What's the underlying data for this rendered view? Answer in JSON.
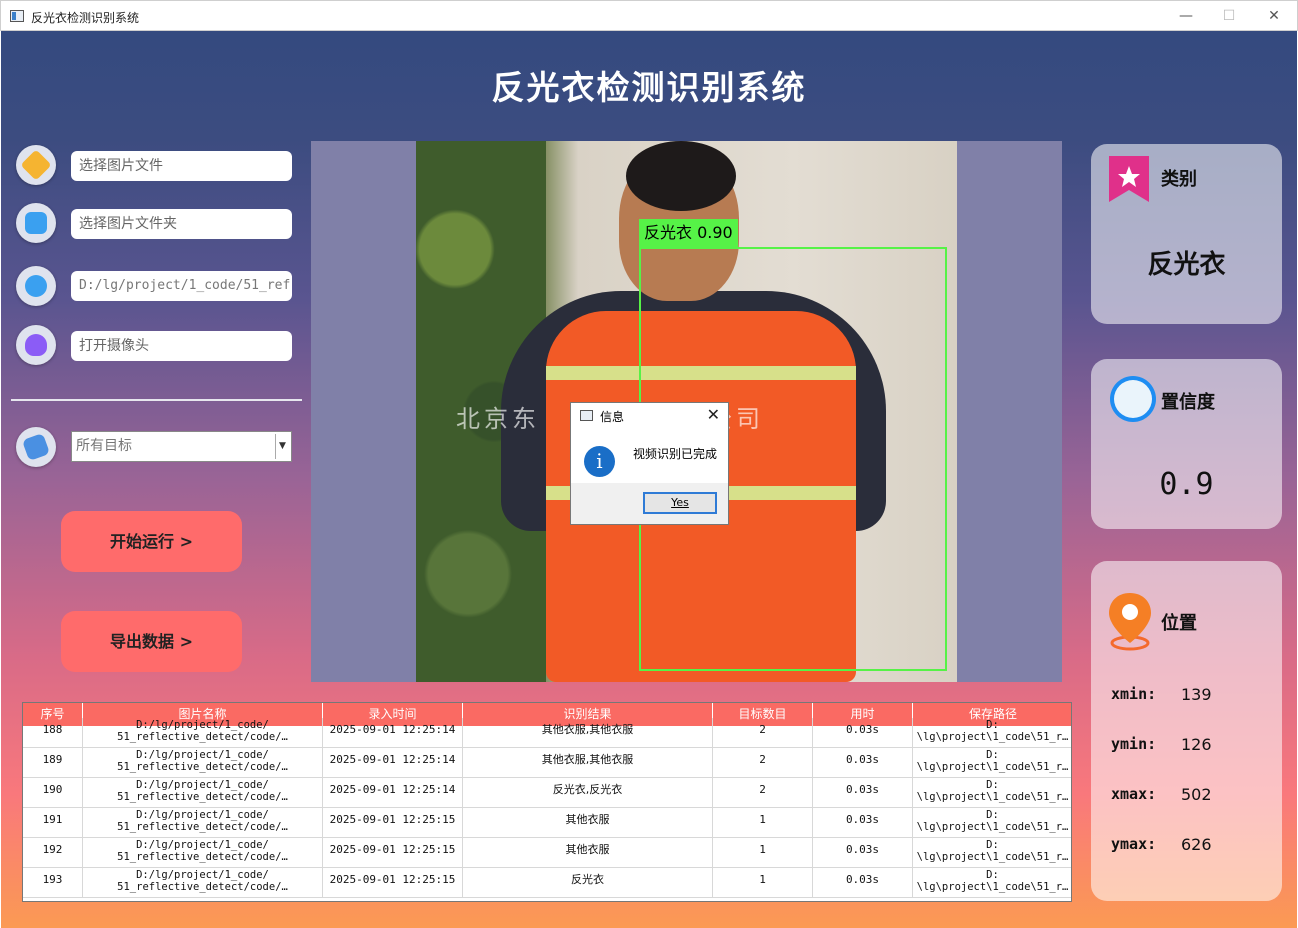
{
  "window": {
    "title": "反光衣检测识别系统",
    "minimize": "—",
    "maximize": "☐",
    "close": "✕"
  },
  "app": {
    "title": "反光衣检测识别系统"
  },
  "sidebar": {
    "image_file_placeholder": "选择图片文件",
    "image_folder_placeholder": "选择图片文件夹",
    "video_path_value": "D:/lg/project/1_code/51_ref",
    "camera_placeholder": "打开摄像头",
    "target_select_value": "所有目标",
    "start_button": "开始运行 >",
    "export_button": "导出数据 >",
    "icon_colors": {
      "image": "#f5b431",
      "folder": "#3aa0f0",
      "video": "#3aa0f0",
      "camera": "#8b5cf6",
      "target": "#4a90e2"
    }
  },
  "viewer": {
    "box_label": "反光衣 0.90",
    "watermark": "北京东　　　技有限公司"
  },
  "dialog": {
    "title": "信息",
    "close": "✕",
    "message": "视频识别已完成",
    "info_glyph": "i",
    "ok_button": "Yes"
  },
  "cards": {
    "class": {
      "title": "类别",
      "value": "反光衣"
    },
    "confidence": {
      "title": "置信度",
      "value": "0.9"
    },
    "position": {
      "title": "位置",
      "xmin_label": "xmin:",
      "xmin": "139",
      "ymin_label": "ymin:",
      "ymin": "126",
      "xmax_label": "xmax:",
      "xmax": "502",
      "ymax_label": "ymax:",
      "ymax": "626"
    }
  },
  "table": {
    "headers": [
      "序号",
      "图片名称",
      "录入时间",
      "识别结果",
      "目标数目",
      "用时",
      "保存路径"
    ],
    "rows": [
      {
        "id": "188",
        "name1": "D:/lg/project/1_code/",
        "name2": "51_reflective_detect/code/…",
        "time": "2025-09-01 12:25:14",
        "result": "其他衣服,其他衣服",
        "count": "2",
        "duration": "0.03s",
        "path1": "D:",
        "path2": "\\lg\\project\\1_code\\51_r…"
      },
      {
        "id": "189",
        "name1": "D:/lg/project/1_code/",
        "name2": "51_reflective_detect/code/…",
        "time": "2025-09-01 12:25:14",
        "result": "其他衣服,其他衣服",
        "count": "2",
        "duration": "0.03s",
        "path1": "D:",
        "path2": "\\lg\\project\\1_code\\51_r…"
      },
      {
        "id": "190",
        "name1": "D:/lg/project/1_code/",
        "name2": "51_reflective_detect/code/…",
        "time": "2025-09-01 12:25:14",
        "result": "反光衣,反光衣",
        "count": "2",
        "duration": "0.03s",
        "path1": "D:",
        "path2": "\\lg\\project\\1_code\\51_r…"
      },
      {
        "id": "191",
        "name1": "D:/lg/project/1_code/",
        "name2": "51_reflective_detect/code/…",
        "time": "2025-09-01 12:25:15",
        "result": "其他衣服",
        "count": "1",
        "duration": "0.03s",
        "path1": "D:",
        "path2": "\\lg\\project\\1_code\\51_r…"
      },
      {
        "id": "192",
        "name1": "D:/lg/project/1_code/",
        "name2": "51_reflective_detect/code/…",
        "time": "2025-09-01 12:25:15",
        "result": "其他衣服",
        "count": "1",
        "duration": "0.03s",
        "path1": "D:",
        "path2": "\\lg\\project\\1_code\\51_r…"
      },
      {
        "id": "193",
        "name1": "D:/lg/project/1_code/",
        "name2": "51_reflective_detect/code/…",
        "time": "2025-09-01 12:25:15",
        "result": "反光衣",
        "count": "1",
        "duration": "0.03s",
        "path1": "D:",
        "path2": "\\lg\\project\\1_code\\51_r…"
      }
    ]
  }
}
